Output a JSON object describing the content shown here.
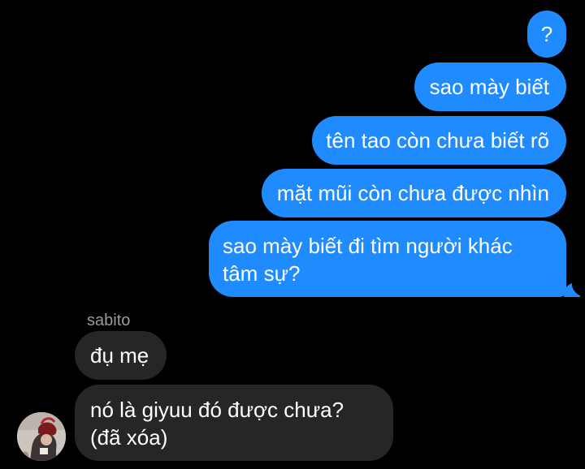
{
  "outgoing_messages": [
    "?",
    "sao mày biết",
    "tên tao còn chưa biết rõ",
    "mặt mũi còn chưa được nhìn",
    "sao mày biết đi tìm người khác\ntâm sự?"
  ],
  "incoming": {
    "sender_name": "sabito",
    "messages": [
      "đụ mẹ",
      "nó là giyuu đó được chưa?\n(đã xóa)"
    ],
    "avatar_icon": "profile-photo"
  },
  "colors": {
    "background": "#000000",
    "outgoing_bubble": "#1f8bff",
    "incoming_bubble": "#262628",
    "sender_label": "#9a9a9f"
  }
}
